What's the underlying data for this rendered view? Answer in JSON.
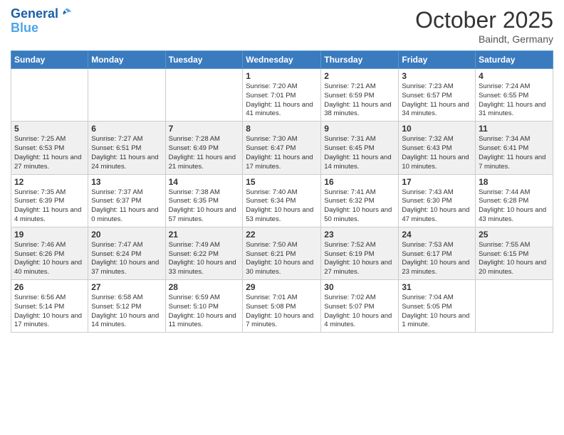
{
  "header": {
    "logo_line1": "General",
    "logo_line2": "Blue",
    "month": "October 2025",
    "location": "Baindt, Germany"
  },
  "weekdays": [
    "Sunday",
    "Monday",
    "Tuesday",
    "Wednesday",
    "Thursday",
    "Friday",
    "Saturday"
  ],
  "weeks": [
    [
      {
        "day": "",
        "info": ""
      },
      {
        "day": "",
        "info": ""
      },
      {
        "day": "",
        "info": ""
      },
      {
        "day": "1",
        "info": "Sunrise: 7:20 AM\nSunset: 7:01 PM\nDaylight: 11 hours and 41 minutes."
      },
      {
        "day": "2",
        "info": "Sunrise: 7:21 AM\nSunset: 6:59 PM\nDaylight: 11 hours and 38 minutes."
      },
      {
        "day": "3",
        "info": "Sunrise: 7:23 AM\nSunset: 6:57 PM\nDaylight: 11 hours and 34 minutes."
      },
      {
        "day": "4",
        "info": "Sunrise: 7:24 AM\nSunset: 6:55 PM\nDaylight: 11 hours and 31 minutes."
      }
    ],
    [
      {
        "day": "5",
        "info": "Sunrise: 7:25 AM\nSunset: 6:53 PM\nDaylight: 11 hours and 27 minutes."
      },
      {
        "day": "6",
        "info": "Sunrise: 7:27 AM\nSunset: 6:51 PM\nDaylight: 11 hours and 24 minutes."
      },
      {
        "day": "7",
        "info": "Sunrise: 7:28 AM\nSunset: 6:49 PM\nDaylight: 11 hours and 21 minutes."
      },
      {
        "day": "8",
        "info": "Sunrise: 7:30 AM\nSunset: 6:47 PM\nDaylight: 11 hours and 17 minutes."
      },
      {
        "day": "9",
        "info": "Sunrise: 7:31 AM\nSunset: 6:45 PM\nDaylight: 11 hours and 14 minutes."
      },
      {
        "day": "10",
        "info": "Sunrise: 7:32 AM\nSunset: 6:43 PM\nDaylight: 11 hours and 10 minutes."
      },
      {
        "day": "11",
        "info": "Sunrise: 7:34 AM\nSunset: 6:41 PM\nDaylight: 11 hours and 7 minutes."
      }
    ],
    [
      {
        "day": "12",
        "info": "Sunrise: 7:35 AM\nSunset: 6:39 PM\nDaylight: 11 hours and 4 minutes."
      },
      {
        "day": "13",
        "info": "Sunrise: 7:37 AM\nSunset: 6:37 PM\nDaylight: 11 hours and 0 minutes."
      },
      {
        "day": "14",
        "info": "Sunrise: 7:38 AM\nSunset: 6:35 PM\nDaylight: 10 hours and 57 minutes."
      },
      {
        "day": "15",
        "info": "Sunrise: 7:40 AM\nSunset: 6:34 PM\nDaylight: 10 hours and 53 minutes."
      },
      {
        "day": "16",
        "info": "Sunrise: 7:41 AM\nSunset: 6:32 PM\nDaylight: 10 hours and 50 minutes."
      },
      {
        "day": "17",
        "info": "Sunrise: 7:43 AM\nSunset: 6:30 PM\nDaylight: 10 hours and 47 minutes."
      },
      {
        "day": "18",
        "info": "Sunrise: 7:44 AM\nSunset: 6:28 PM\nDaylight: 10 hours and 43 minutes."
      }
    ],
    [
      {
        "day": "19",
        "info": "Sunrise: 7:46 AM\nSunset: 6:26 PM\nDaylight: 10 hours and 40 minutes."
      },
      {
        "day": "20",
        "info": "Sunrise: 7:47 AM\nSunset: 6:24 PM\nDaylight: 10 hours and 37 minutes."
      },
      {
        "day": "21",
        "info": "Sunrise: 7:49 AM\nSunset: 6:22 PM\nDaylight: 10 hours and 33 minutes."
      },
      {
        "day": "22",
        "info": "Sunrise: 7:50 AM\nSunset: 6:21 PM\nDaylight: 10 hours and 30 minutes."
      },
      {
        "day": "23",
        "info": "Sunrise: 7:52 AM\nSunset: 6:19 PM\nDaylight: 10 hours and 27 minutes."
      },
      {
        "day": "24",
        "info": "Sunrise: 7:53 AM\nSunset: 6:17 PM\nDaylight: 10 hours and 23 minutes."
      },
      {
        "day": "25",
        "info": "Sunrise: 7:55 AM\nSunset: 6:15 PM\nDaylight: 10 hours and 20 minutes."
      }
    ],
    [
      {
        "day": "26",
        "info": "Sunrise: 6:56 AM\nSunset: 5:14 PM\nDaylight: 10 hours and 17 minutes."
      },
      {
        "day": "27",
        "info": "Sunrise: 6:58 AM\nSunset: 5:12 PM\nDaylight: 10 hours and 14 minutes."
      },
      {
        "day": "28",
        "info": "Sunrise: 6:59 AM\nSunset: 5:10 PM\nDaylight: 10 hours and 11 minutes."
      },
      {
        "day": "29",
        "info": "Sunrise: 7:01 AM\nSunset: 5:08 PM\nDaylight: 10 hours and 7 minutes."
      },
      {
        "day": "30",
        "info": "Sunrise: 7:02 AM\nSunset: 5:07 PM\nDaylight: 10 hours and 4 minutes."
      },
      {
        "day": "31",
        "info": "Sunrise: 7:04 AM\nSunset: 5:05 PM\nDaylight: 10 hours and 1 minute."
      },
      {
        "day": "",
        "info": ""
      }
    ]
  ]
}
